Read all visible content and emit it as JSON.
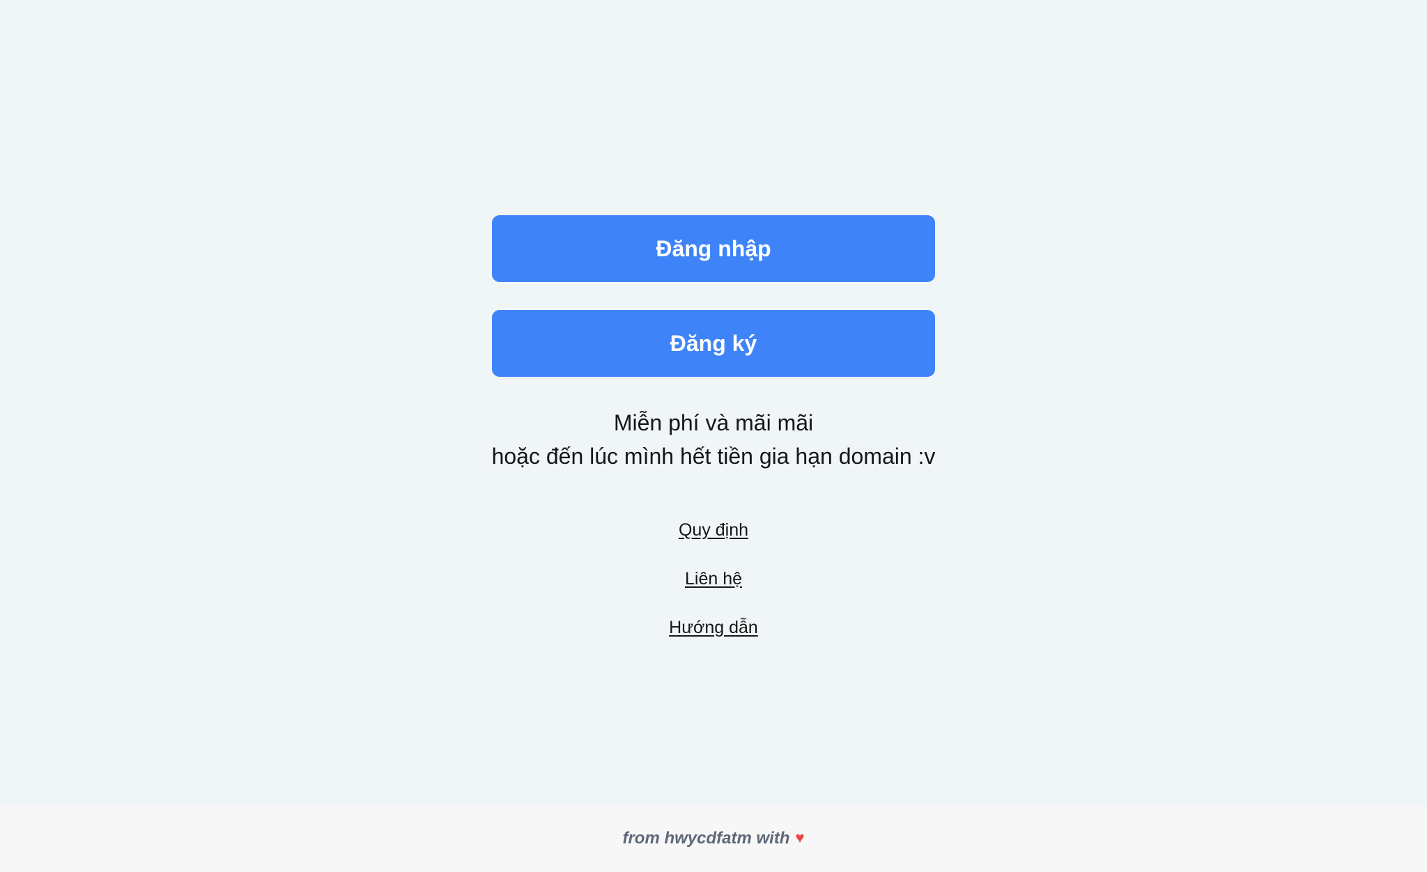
{
  "auth": {
    "login_label": "Đăng nhập",
    "register_label": "Đăng ký"
  },
  "tagline": {
    "line1": "Miễn phí và mãi mãi",
    "line2": "hoặc đến lúc mình hết tiền gia hạn domain :v"
  },
  "links": {
    "rules": "Quy định",
    "contact": "Liên hệ",
    "guide": "Hướng dẫn"
  },
  "footer": {
    "text": "from hwycdfatm with",
    "heart_glyph": "♥",
    "icon": "heart-icon"
  },
  "colors": {
    "background": "#f0f5f8",
    "button": "#3e84f8",
    "button_text": "#ffffff",
    "footer_background": "#f7f7f7",
    "footer_text": "#5e6878",
    "heart": "#ef4444"
  }
}
